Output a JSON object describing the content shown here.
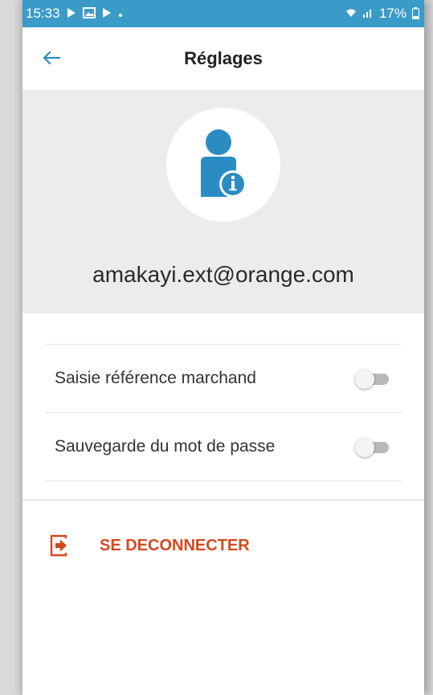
{
  "status_bar": {
    "time": "15:33",
    "battery": "17%",
    "left_icons": [
      "play-store-icon",
      "image-icon",
      "play-icon",
      "dot-icon"
    ],
    "right_icons": [
      "wifi-icon",
      "signal-icon",
      "battery-icon"
    ]
  },
  "header": {
    "title": "Réglages",
    "back_icon": "arrow-left-icon"
  },
  "profile": {
    "avatar_icon": "user-info-icon",
    "email": "amakayi.ext@orange.com"
  },
  "settings": {
    "items": [
      {
        "label": "Saisie référence marchand",
        "enabled": false
      },
      {
        "label": "Sauvegarde du mot de passe",
        "enabled": false
      }
    ]
  },
  "logout": {
    "label": "SE DECONNECTER",
    "icon": "logout-icon"
  },
  "colors": {
    "status_bar": "#3a9bc9",
    "accent_blue": "#2b8cc4",
    "logout_red": "#d5481f",
    "profile_bg": "#ececec"
  }
}
